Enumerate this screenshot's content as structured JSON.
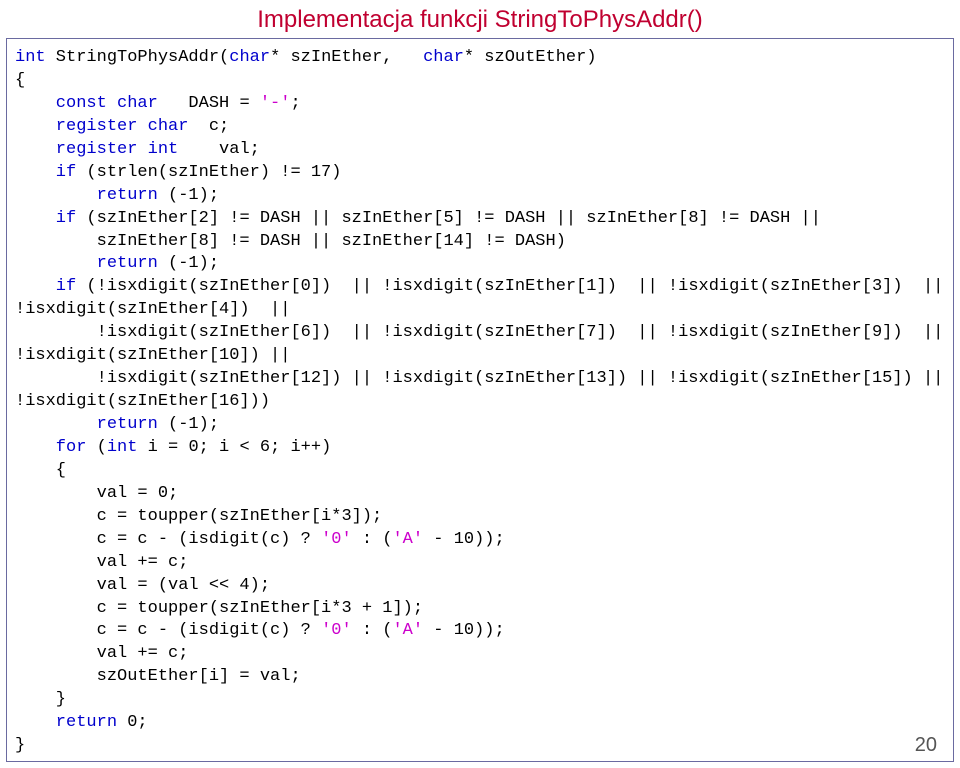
{
  "title": "Implementacja funkcji StringToPhysAddr()",
  "page_number": "20",
  "code": {
    "l01a": "int",
    "l01b": " StringToPhysAddr(",
    "l01c": "char",
    "l01d": "* szInEther,   ",
    "l01e": "char",
    "l01f": "* szOutEther)",
    "l02": "{",
    "l03a": "    const char",
    "l03b": "   DASH = ",
    "l03c": "'-'",
    "l03d": ";",
    "l04a": "    register char",
    "l04b": "  c;",
    "l05a": "    register int",
    "l05b": "    val;",
    "l06a": "    if",
    "l06b": " (strlen(szInEther) != 17)",
    "l07a": "        return",
    "l07b": " (-1);",
    "l08a": "    if",
    "l08b": " (szInEther[2] != DASH || szInEther[5] != DASH || szInEther[8] != DASH ||",
    "l09": "        szInEther[8] != DASH || szInEther[14] != DASH)",
    "l10a": "        return",
    "l10b": " (-1);",
    "l11a": "    if",
    "l11b": " (!isxdigit(szInEther[0])  || !isxdigit(szInEther[1])  || !isxdigit(szInEther[3])  ||",
    "l12": "!isxdigit(szInEther[4])  ||",
    "l13": "        !isxdigit(szInEther[6])  || !isxdigit(szInEther[7])  || !isxdigit(szInEther[9])  ||",
    "l14": "!isxdigit(szInEther[10]) ||",
    "l15": "        !isxdigit(szInEther[12]) || !isxdigit(szInEther[13]) || !isxdigit(szInEther[15]) ||",
    "l16": "!isxdigit(szInEther[16]))",
    "l17a": "        return",
    "l17b": " (-1);",
    "l18a": "    for",
    "l18b": " (",
    "l18c": "int",
    "l18d": " i = 0; i < 6; i++)",
    "l19": "    {",
    "l20": "        val = 0;",
    "l21": "        c = toupper(szInEther[i*3]);",
    "l22a": "        c = c - (isdigit(c) ? ",
    "l22b": "'0'",
    "l22c": " : (",
    "l22d": "'A'",
    "l22e": " - 10));",
    "l23": "        val += c;",
    "l24": "        val = (val << 4);",
    "l25": "        c = toupper(szInEther[i*3 + 1]);",
    "l26a": "        c = c - (isdigit(c) ? ",
    "l26b": "'0'",
    "l26c": " : (",
    "l26d": "'A'",
    "l26e": " - 10));",
    "l27": "        val += c;",
    "l28": "        szOutEther[i] = val;",
    "l29": "    }",
    "l30a": "    return",
    "l30b": " 0;",
    "l31": "}"
  }
}
